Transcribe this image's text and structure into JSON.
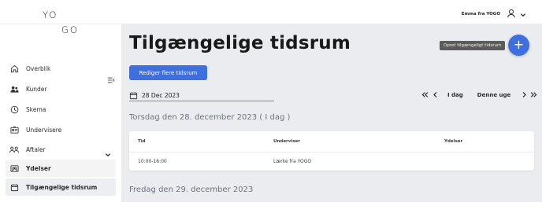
{
  "header": {
    "logo_line1": "YO",
    "logo_line2": "GO",
    "user_name": "Emma fra YOGO"
  },
  "sidebar": {
    "items": [
      {
        "label": "Overblik",
        "icon": "home-icon"
      },
      {
        "label": "Kunder",
        "icon": "users-icon"
      },
      {
        "label": "Skema",
        "icon": "clock-icon"
      },
      {
        "label": "Undervisere",
        "icon": "id-card-icon"
      },
      {
        "label": "Aftaler",
        "icon": "people-icon",
        "expanded": true
      },
      {
        "label": "Ydelser",
        "icon": "services-icon"
      },
      {
        "label": "Tilgængelige tidsrum",
        "icon": "calendar-icon",
        "active": true
      }
    ]
  },
  "main": {
    "title": "Tilgængelige tidsrum",
    "tooltip": "Opret tilgængeligt tidsrum",
    "fab_label": "+",
    "edit_button": "Rediger flere tidsrum",
    "date_value": "28 Dec 2023",
    "nav": {
      "today": "I dag",
      "this_week": "Denne uge"
    },
    "days": [
      {
        "heading": "Torsdag den 28. december 2023 ( I dag )",
        "columns": [
          "Tid",
          "Underviser",
          "Ydelser"
        ],
        "rows": [
          {
            "tid": "10:00-16:00",
            "underviser": "Lærke fra YOGO",
            "ydelser": ""
          }
        ]
      },
      {
        "heading": "Fredag den 29. december 2023"
      }
    ]
  },
  "colors": {
    "accent": "#3f6fdf",
    "main_bg": "#ebecef",
    "heading_muted": "#6b7380"
  }
}
